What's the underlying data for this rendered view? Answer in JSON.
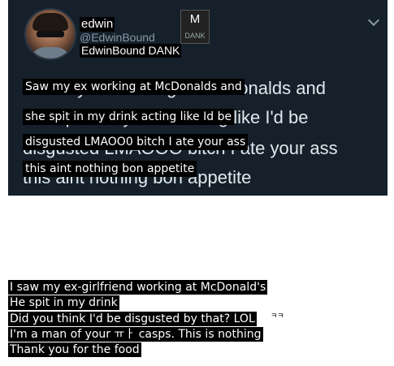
{
  "tweet": {
    "display_name": "edwin",
    "handle_ghost": "@EdwinBound",
    "badge_letter": "M",
    "badge_text": "DANK",
    "subtitle_label": "EdwinBound DANK",
    "background_text": [
      "Saw my ex working at McDonalds and",
      "she spit in my drink acting like I'd be",
      "disgusted LMAOOO bitch I ate your ass",
      "this aint nothing bon appetite"
    ],
    "overlay_text": [
      "Saw my ex working at McDonalds and",
      "she spit in my drink acting like Id be",
      "disgusted LMAOO0 bitch I ate your ass",
      "this aint nothing bon appetite"
    ]
  },
  "translation": [
    "I saw my ex-girlfriend working at McDonald's",
    "He spit in my drink",
    "Did you think I'd be disgusted by that? LOL",
    "I'm a man of your ㅠㅏ casps. This is nothing",
    "Thank you for the food"
  ],
  "stray_glyph": "ㅋㅋ"
}
